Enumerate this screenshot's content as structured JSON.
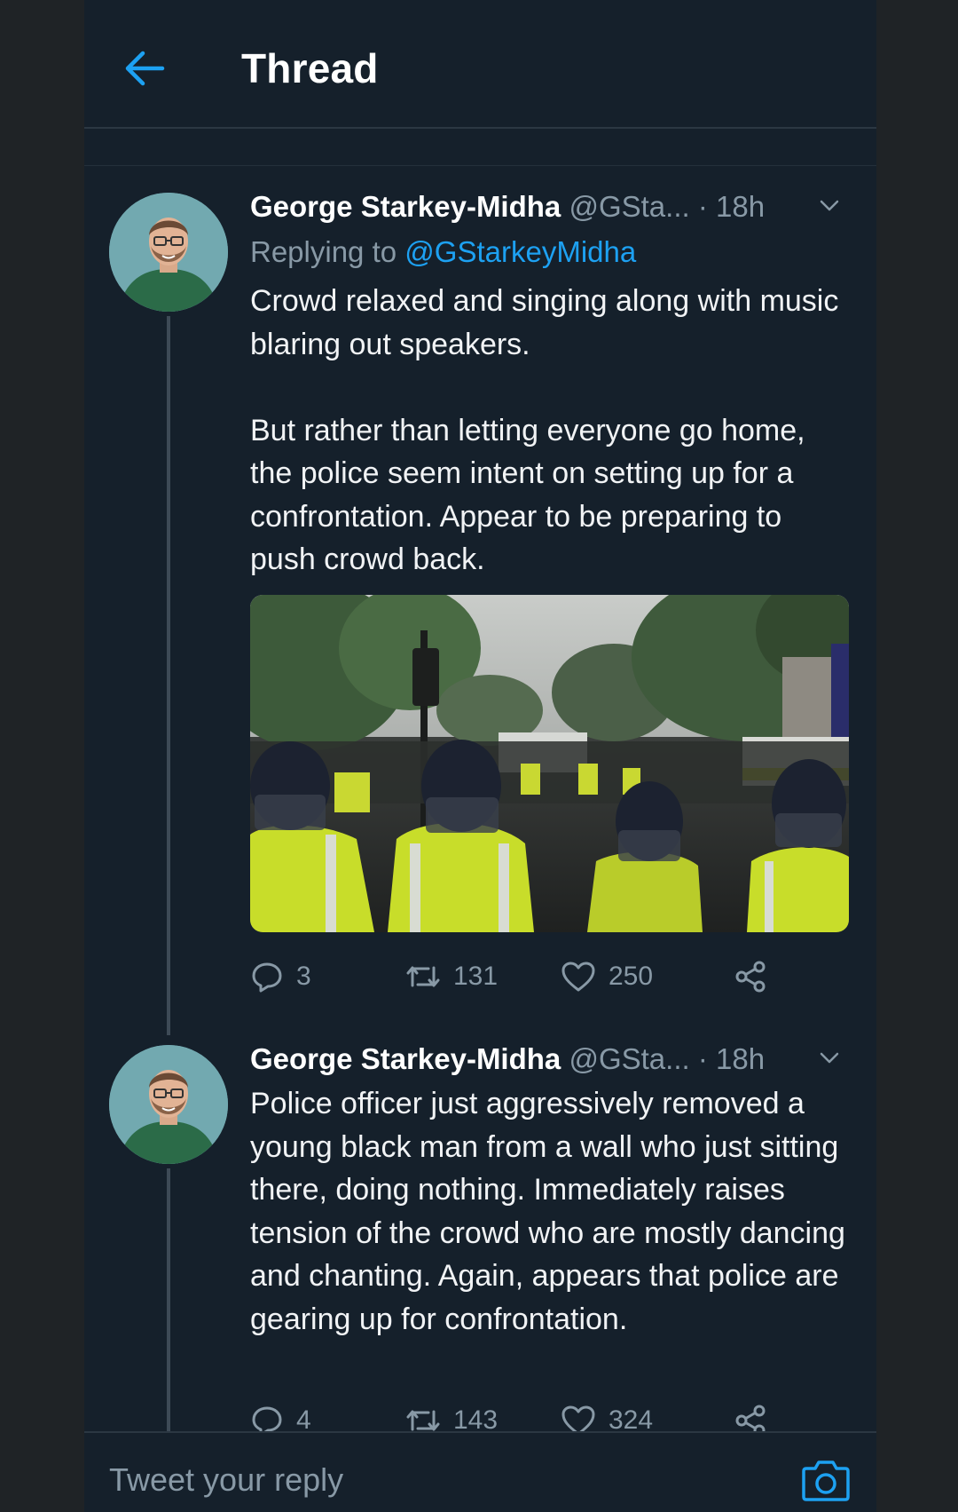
{
  "header": {
    "title": "Thread",
    "back_icon": "arrow-left-icon"
  },
  "colors": {
    "background": "#15202b",
    "accent": "#1da1f2",
    "text_primary": "#ffffff",
    "text_secondary": "#8899a6",
    "divider": "#2b3742"
  },
  "tweets": [
    {
      "author_name": "George Starkey-Midha",
      "handle": "@GSta...",
      "separator": "·",
      "time": "18h",
      "replying_prefix": "Replying to",
      "replying_to": "@GStarkeyMidha",
      "text": "Crowd relaxed and singing along with music blaring out speakers.\n\nBut rather than letting everyone go home, the police seem intent on setting up for a confrontation. Appear to be preparing to push crowd back.",
      "has_photo": true,
      "replies": "3",
      "retweets": "131",
      "likes": "250"
    },
    {
      "author_name": "George Starkey-Midha",
      "handle": "@GSta...",
      "separator": "·",
      "time": "18h",
      "text": "Police officer just aggressively removed a young black man from a wall who just sitting there, doing nothing. Immediately raises tension of the crowd who are mostly dancing and chanting. Again, appears that police are gearing up for confrontation.",
      "replies": "4",
      "retweets": "143",
      "likes": "324"
    }
  ],
  "reply_bar": {
    "placeholder": "Tweet your reply",
    "camera_icon": "camera-icon"
  }
}
